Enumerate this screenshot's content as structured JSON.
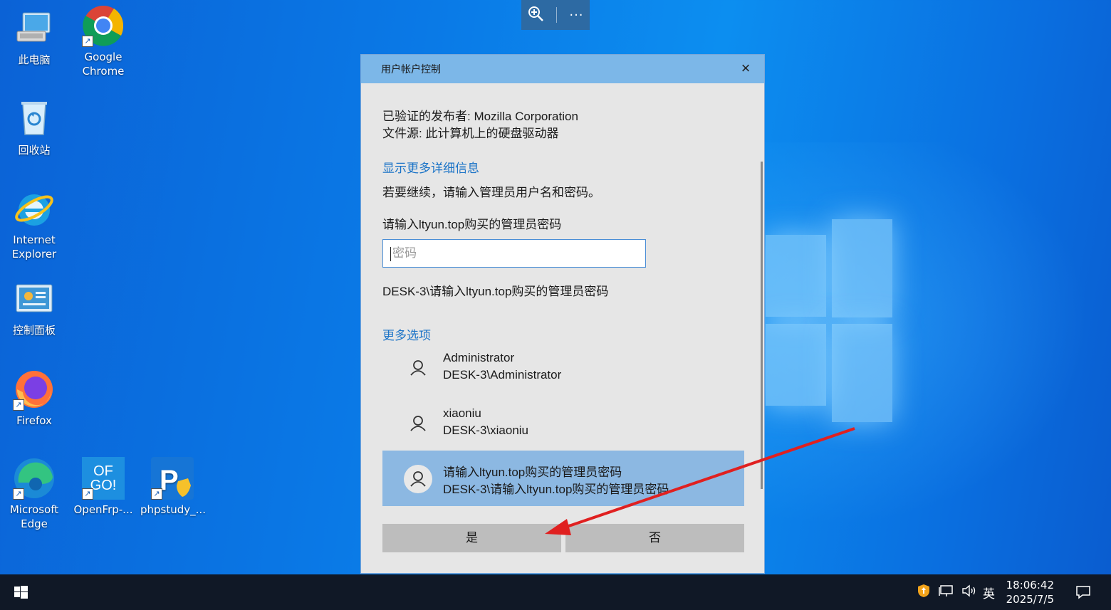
{
  "desktop": {
    "icons": [
      {
        "label": "此电脑",
        "icon": "this-pc-icon"
      },
      {
        "label": "Google Chrome",
        "icon": "chrome-icon"
      },
      {
        "label": "回收站",
        "icon": "recycle-bin-icon"
      },
      {
        "label": "Internet Explorer",
        "icon": "ie-icon"
      },
      {
        "label": "控制面板",
        "icon": "control-panel-icon"
      },
      {
        "label": "Firefox",
        "icon": "firefox-icon"
      },
      {
        "label": "Microsoft Edge",
        "icon": "edge-icon"
      },
      {
        "label": "OpenFrp-...",
        "icon": "openfrp-icon",
        "badge": "OF GO!"
      },
      {
        "label": "phpstudy_...",
        "icon": "phpstudy-icon"
      }
    ]
  },
  "magnifier": {
    "zoom_icon": "zoom-in-icon",
    "more_label": "···"
  },
  "uac": {
    "title": "用户帐户控制",
    "publisher": "已验证的发布者: Mozilla Corporation",
    "origin": "文件源: 此计算机上的硬盘驱动器",
    "details_link": "显示更多详细信息",
    "prompt": "若要继续，请输入管理员用户名和密码。",
    "user_heading": "请输入ltyun.top购买的管理员密码",
    "password_placeholder": "密码",
    "domain_user": "DESK-3\\请输入ltyun.top购买的管理员密码",
    "more_options": "更多选项",
    "accounts": [
      {
        "name": "Administrator",
        "sub": "DESK-3\\Administrator"
      },
      {
        "name": "xiaoniu",
        "sub": "DESK-3\\xiaoniu"
      },
      {
        "name": "请输入ltyun.top购买的管理员密码",
        "sub": "DESK-3\\请输入ltyun.top购买的管理员密码"
      }
    ],
    "yes_label": "是",
    "no_label": "否"
  },
  "taskbar": {
    "ime": "英",
    "time": "18:06:42",
    "date": "2025/7/5"
  },
  "colors": {
    "dialog_title_bar": "#7cb7e8",
    "selected_account": "#8cb8e2",
    "link": "#1a73c7",
    "annotation_arrow": "#e02020"
  }
}
